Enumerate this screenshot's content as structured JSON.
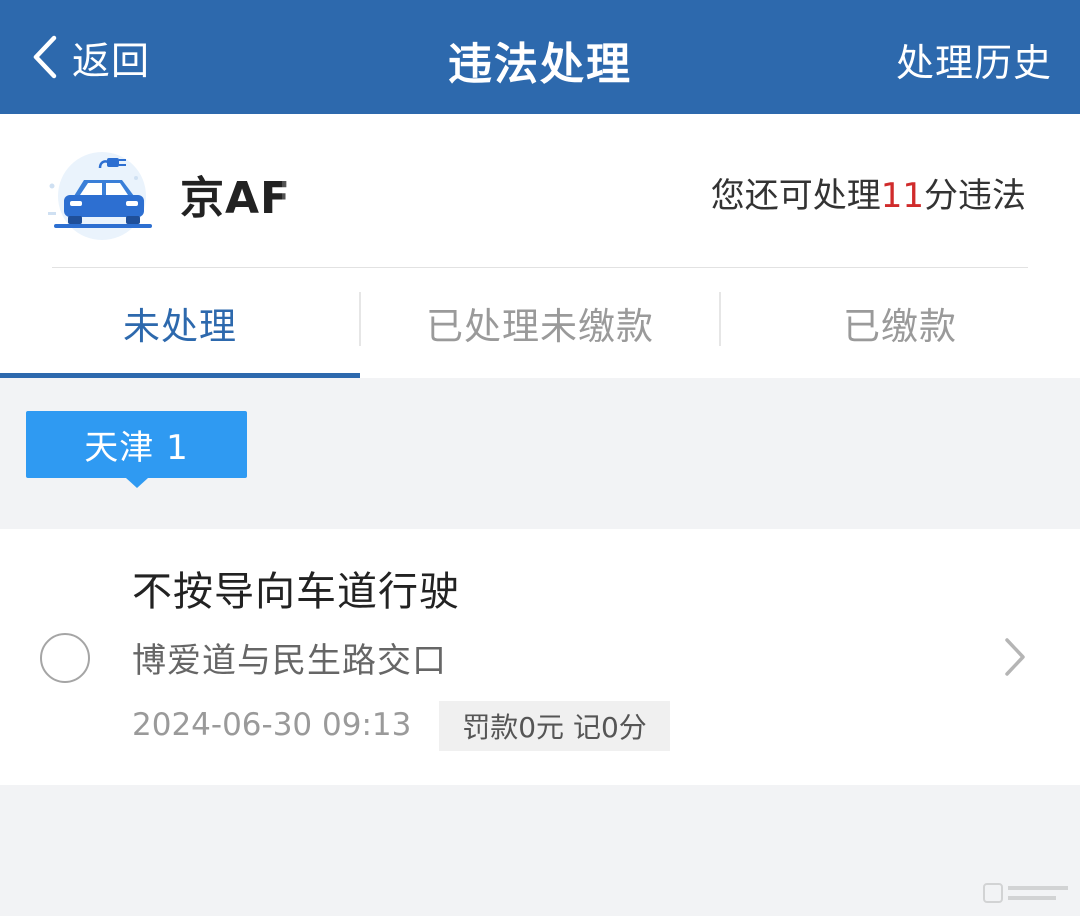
{
  "header": {
    "back_label": "返回",
    "title": "违法处理",
    "history_label": "处理历史"
  },
  "vehicle": {
    "plate": "京AF",
    "points_prefix": "您还可处理",
    "points_value": "11",
    "points_suffix": "分违法",
    "icon": "electric-car-icon"
  },
  "tabs": [
    {
      "label": "未处理",
      "active": true
    },
    {
      "label": "已处理未缴款",
      "active": false
    },
    {
      "label": "已缴款",
      "active": false
    }
  ],
  "region_badge": {
    "label": "天津 1"
  },
  "violations": [
    {
      "title": "不按导向车道行驶",
      "location": "博爱道与民生路交口",
      "time": "2024-06-30 09:13",
      "penalty": "罚款0元 记0分"
    }
  ],
  "colors": {
    "header_bg": "#2d69ad",
    "active_tab": "#2d69ad",
    "badge_bg": "#2f9af2",
    "points_highlight": "#d02b2b"
  }
}
